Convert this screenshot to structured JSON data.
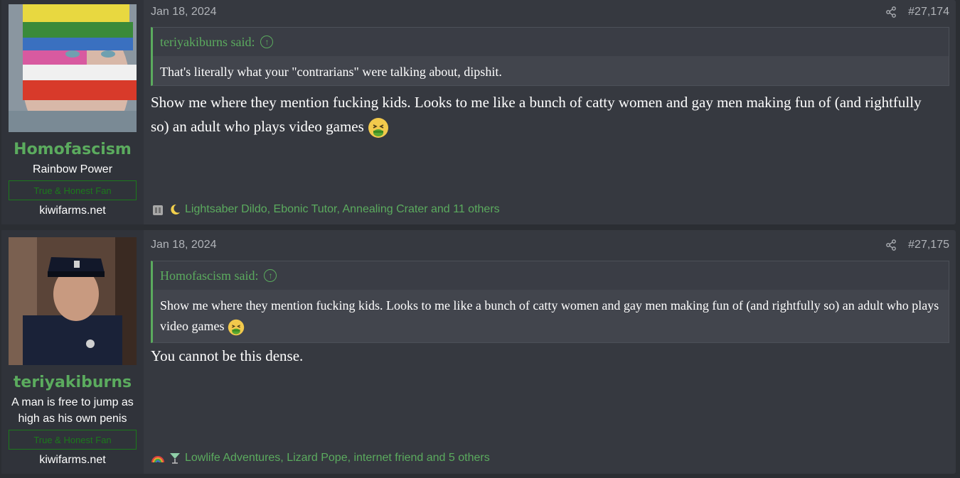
{
  "posts": [
    {
      "user": {
        "name": "Homofascism",
        "title": "Rainbow Power",
        "banner": "True & Honest Fan",
        "site": "kiwifarms.net"
      },
      "date": "Jan 18, 2024",
      "post_number": "#27,174",
      "quote": {
        "author": "teriyakiburns said:",
        "text": "That's literally what your \"contrarians\" were talking about, dipshit."
      },
      "body": "Show me where they mention fucking kids. Looks to me like a bunch of catty women and gay men making fun of (and rightfully so) an adult who plays video games",
      "reactions": "Lightsaber Dildo, Ebonic Tutor, Annealing Crater and 11 others"
    },
    {
      "user": {
        "name": "teriyakiburns",
        "title": "A man is free to jump as high as his own penis",
        "banner": "True & Honest Fan",
        "site": "kiwifarms.net"
      },
      "date": "Jan 18, 2024",
      "post_number": "#27,175",
      "quote": {
        "author": "Homofascism said:",
        "text": "Show me where they mention fucking kids. Looks to me like a bunch of catty women and gay men making fun of (and rightfully so) an adult who plays video games"
      },
      "body": "You cannot be this dense.",
      "reactions": "Lowlife Adventures, Lizard Pope, internet friend and 5 others"
    }
  ],
  "colors": {
    "accent": "#5bab5e",
    "post_bg": "#363940",
    "user_bg": "#30333a",
    "banner": "#1c7a1c"
  },
  "icons": {
    "share": "share-icon",
    "quote_jump": "arrow-up-circle-icon",
    "emoji": "nauseated-face-emoji"
  }
}
